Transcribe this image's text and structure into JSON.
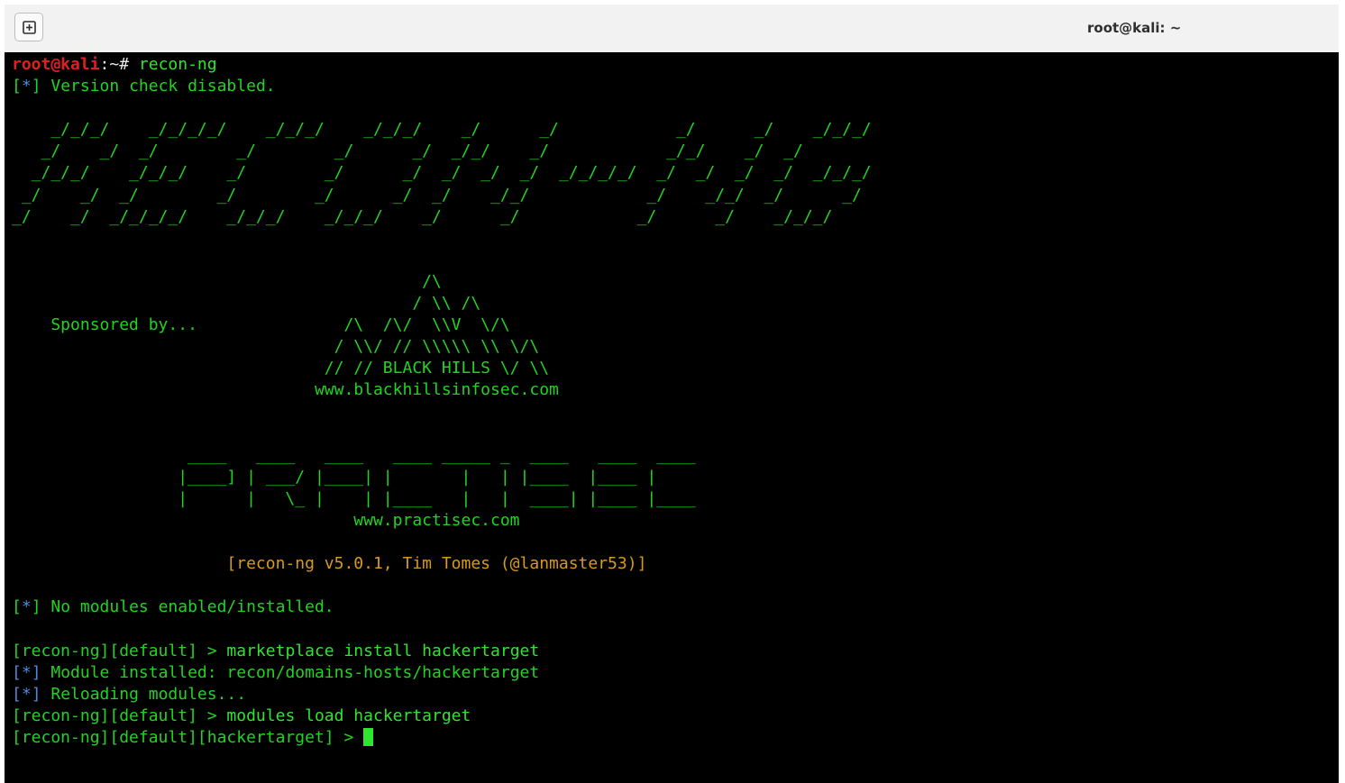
{
  "window": {
    "title": "root@kali: ~",
    "new_tab_icon": "plus-box-icon"
  },
  "colors": {
    "terminal_bg": "#000000",
    "text_green": "#20d420",
    "prompt_red": "#e02020",
    "info_blue": "#4a8ad8",
    "banner_orange": "#d89a1c"
  },
  "terminal": {
    "prompt_user": "root@kali",
    "prompt_path": ":~#",
    "first_command": " recon-ng",
    "bracket_open": "[",
    "star": "*",
    "bracket_close": "]",
    "version_msg": " Version check disabled.",
    "logo_lines": [
      "    _/_/_/    _/_/_/_/    _/_/_/    _/_/_/    _/      _/            _/      _/    _/_/_/",
      "   _/    _/  _/        _/        _/      _/  _/_/    _/            _/_/    _/  _/",
      "  _/_/_/    _/_/_/    _/        _/      _/  _/  _/  _/  _/_/_/_/  _/  _/  _/  _/  _/_/_/",
      " _/    _/  _/        _/        _/      _/  _/    _/_/            _/    _/_/  _/      _/",
      "_/    _/  _/_/_/_/    _/_/_/    _/_/_/    _/      _/            _/      _/    _/_/_/"
    ],
    "bhis_lines": [
      "                                          /\\",
      "                                         / \\\\ /\\",
      "    Sponsored by...               /\\  /\\/  \\\\V  \\/\\",
      "                                 / \\\\/ // \\\\\\\\\\ \\\\ \\/\\",
      "                                // // BLACK HILLS \\/ \\\\",
      "                               www.blackhillsinfosec.com"
    ],
    "practisec_lines": [
      "                  ____   ____   ____   ____ _____ _  ____   ____  ____",
      "                 |____] | ___/ |____| |       |   | |____  |____ |",
      "                 |      |   \\_ |    | |____   |   |  ____| |____ |____",
      "                                   www.practisec.com"
    ],
    "banner": "                      [recon-ng v5.0.1, Tim Tomes (@lanmaster53)]",
    "no_modules_msg": " No modules enabled/installed.",
    "cmd1_prompt": "[recon-ng][default] > ",
    "cmd1": "marketplace install hackertarget",
    "installed_msg": " Module installed: recon/domains-hosts/hackertarget",
    "reloading_msg": " Reloading modules...",
    "cmd2_prompt": "[recon-ng][default] > ",
    "cmd2": "modules load hackertarget",
    "cmd3_prompt": "[recon-ng][default][hackertarget] > "
  }
}
